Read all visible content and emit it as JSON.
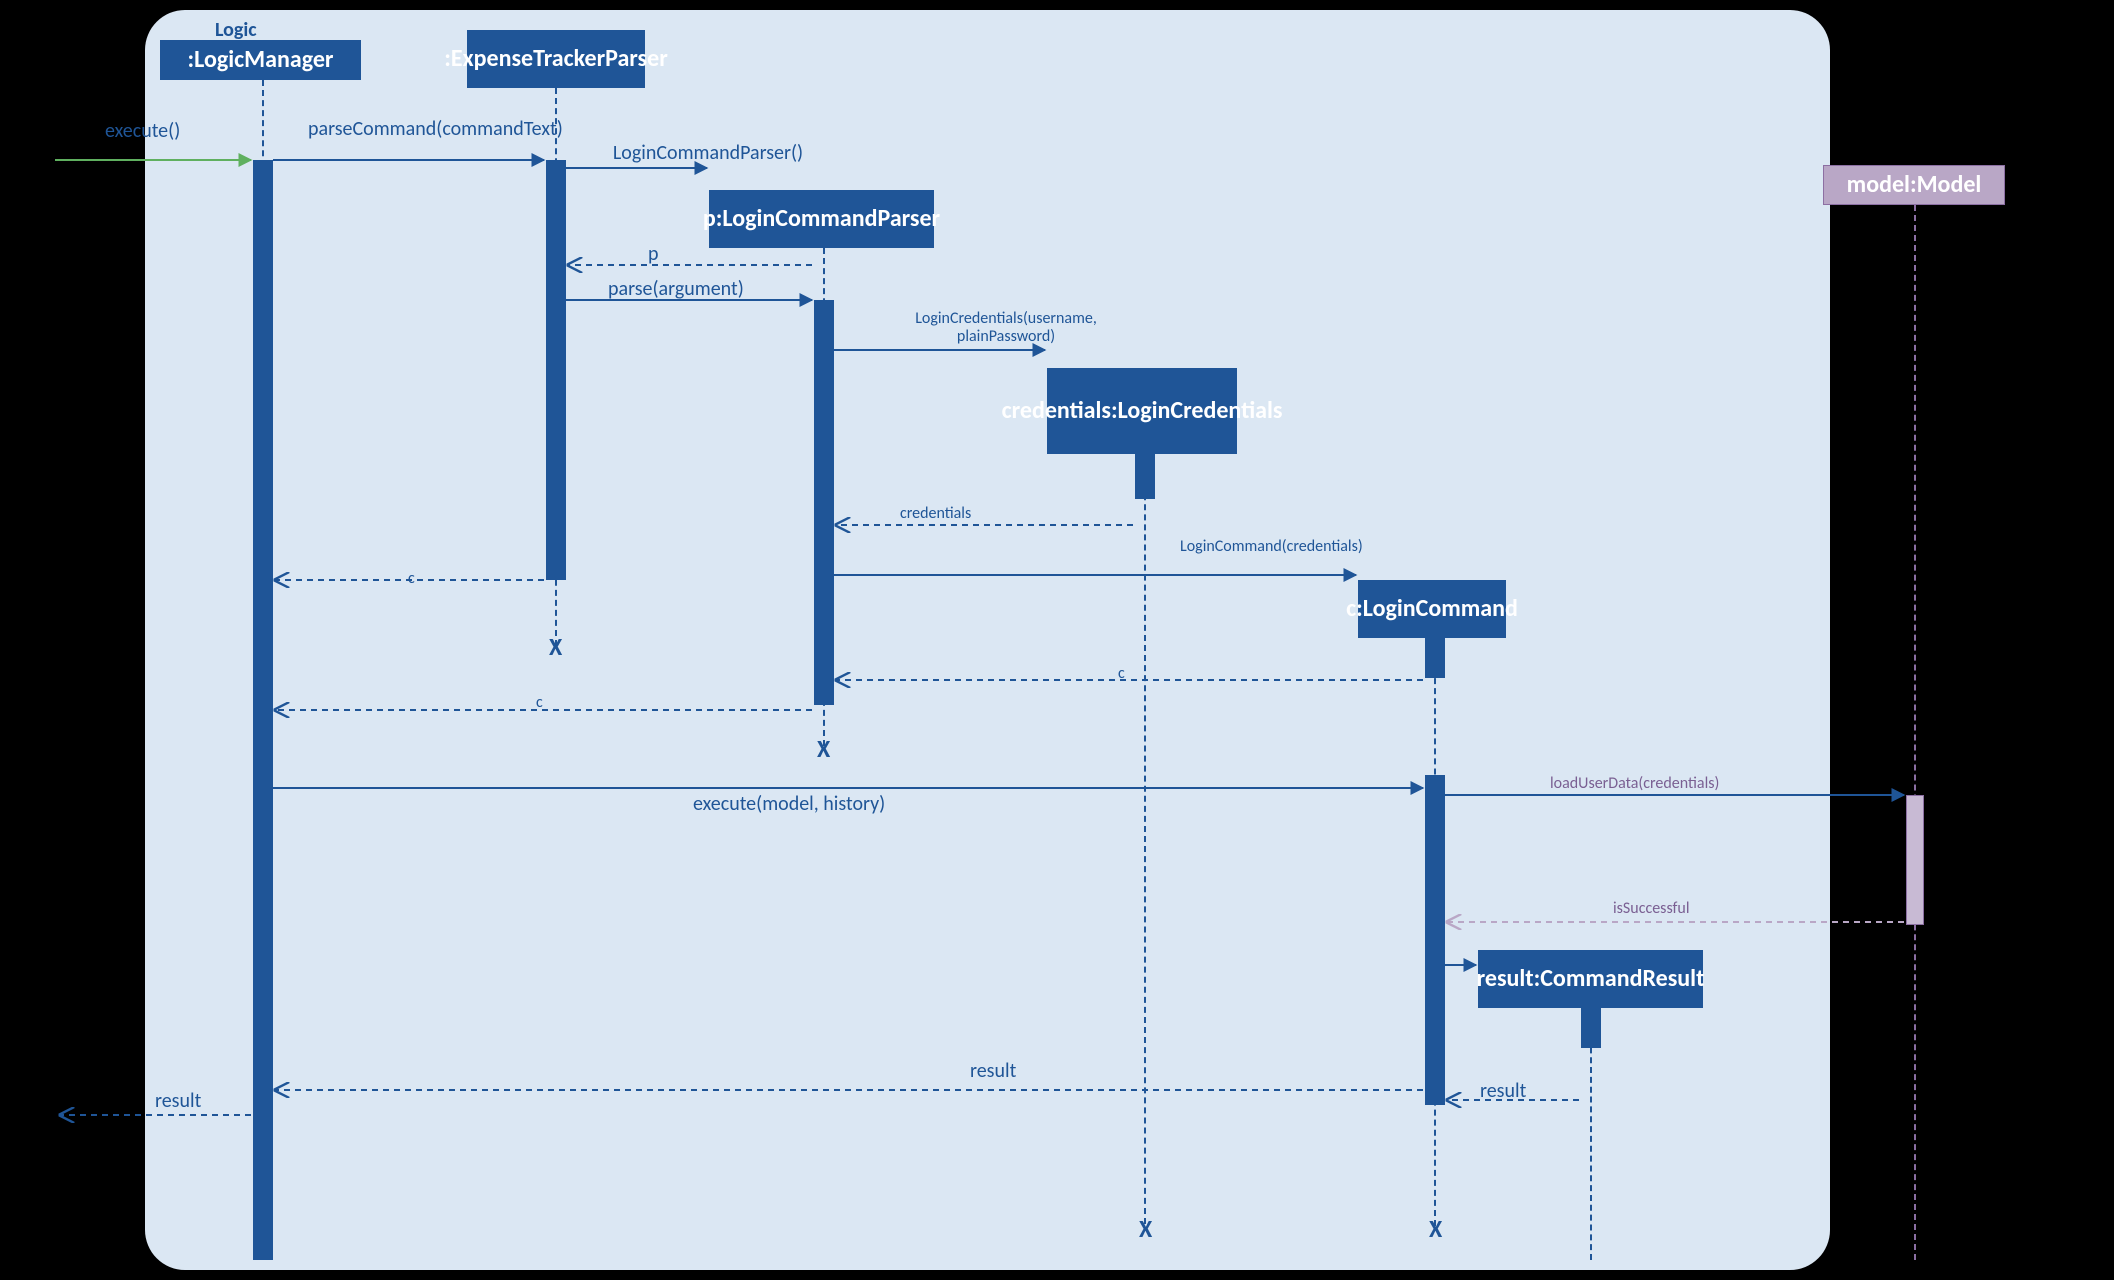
{
  "frame_label": "Logic",
  "participants": {
    "logicManager": ":LogicManager",
    "expenseTrackerParser": ":ExpenseTrackerParser",
    "loginCommandParser": "p:LoginCommandParser",
    "loginCredentials": "credentials:LoginCredentials",
    "loginCommand": "c:LoginCommand",
    "commandResult": "result:CommandResult",
    "model": "model:Model"
  },
  "messages": {
    "execute_in": "execute()",
    "parseCommand": "parseCommand(commandText)",
    "loginCommandParser_ctor": "LoginCommandParser()",
    "return_p": "p",
    "parse_arg": "parse(argument)",
    "loginCredentials_ctor": "LoginCredentials(username, plainPassword)",
    "return_credentials": "credentials",
    "loginCommand_ctor": "LoginCommand(credentials)",
    "return_c1": "c",
    "return_c2": "c",
    "return_c3": "c",
    "execute_model": "execute(model, history)",
    "loadUserData": "loadUserData(credentials)",
    "isSuccessful": "isSuccessful",
    "return_result1": "result",
    "return_result2": "result",
    "return_result3": "result"
  },
  "destroy_marks": {
    "etp": "X",
    "lcp": "X",
    "cred": "X",
    "cmd": "X"
  },
  "colors": {
    "primary": "#1f5597",
    "model_fill": "#b9a7c6",
    "frame_bg": "#dbe7f3",
    "green": "#5fb05f"
  }
}
